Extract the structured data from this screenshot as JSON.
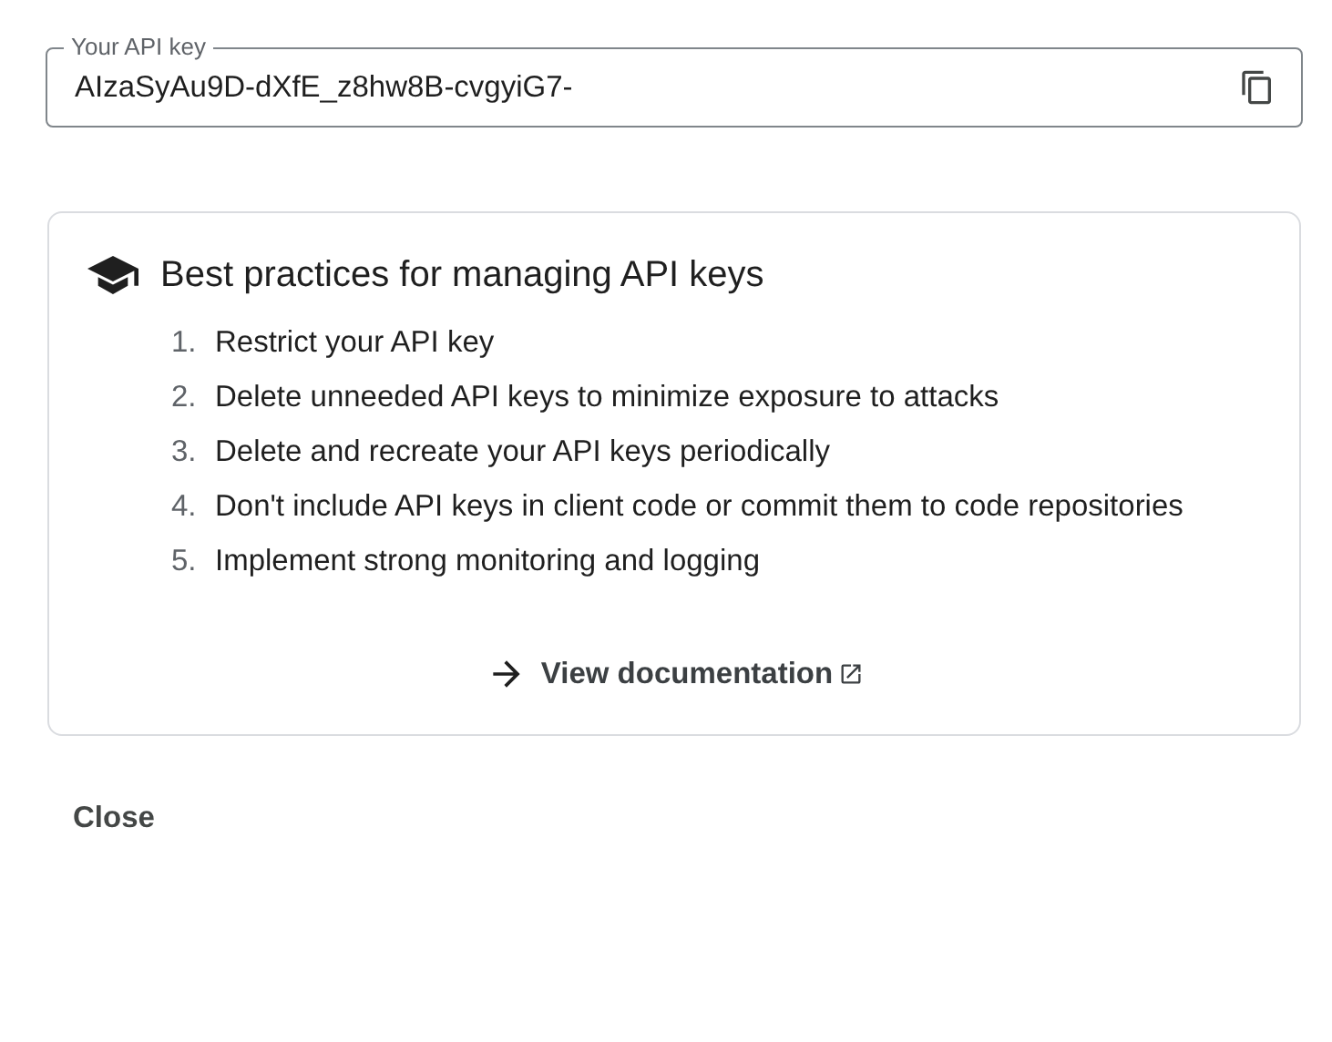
{
  "api_key_field": {
    "label": "Your API key",
    "value": "AIzaSyAu9D-dXfE_z8hw8B-cvgyiG7-"
  },
  "best_practices": {
    "title": "Best practices for managing API keys",
    "items": [
      {
        "number": "1.",
        "text": "Restrict your API key"
      },
      {
        "number": "2.",
        "text": "Delete unneeded API keys to minimize exposure to attacks"
      },
      {
        "number": "3.",
        "text": "Delete and recreate your API keys periodically"
      },
      {
        "number": "4.",
        "text": "Don't include API keys in client code or commit them to code repositories"
      },
      {
        "number": "5.",
        "text": "Implement strong monitoring and logging"
      }
    ],
    "link": "View documentation"
  },
  "buttons": [
    "Close"
  ]
}
